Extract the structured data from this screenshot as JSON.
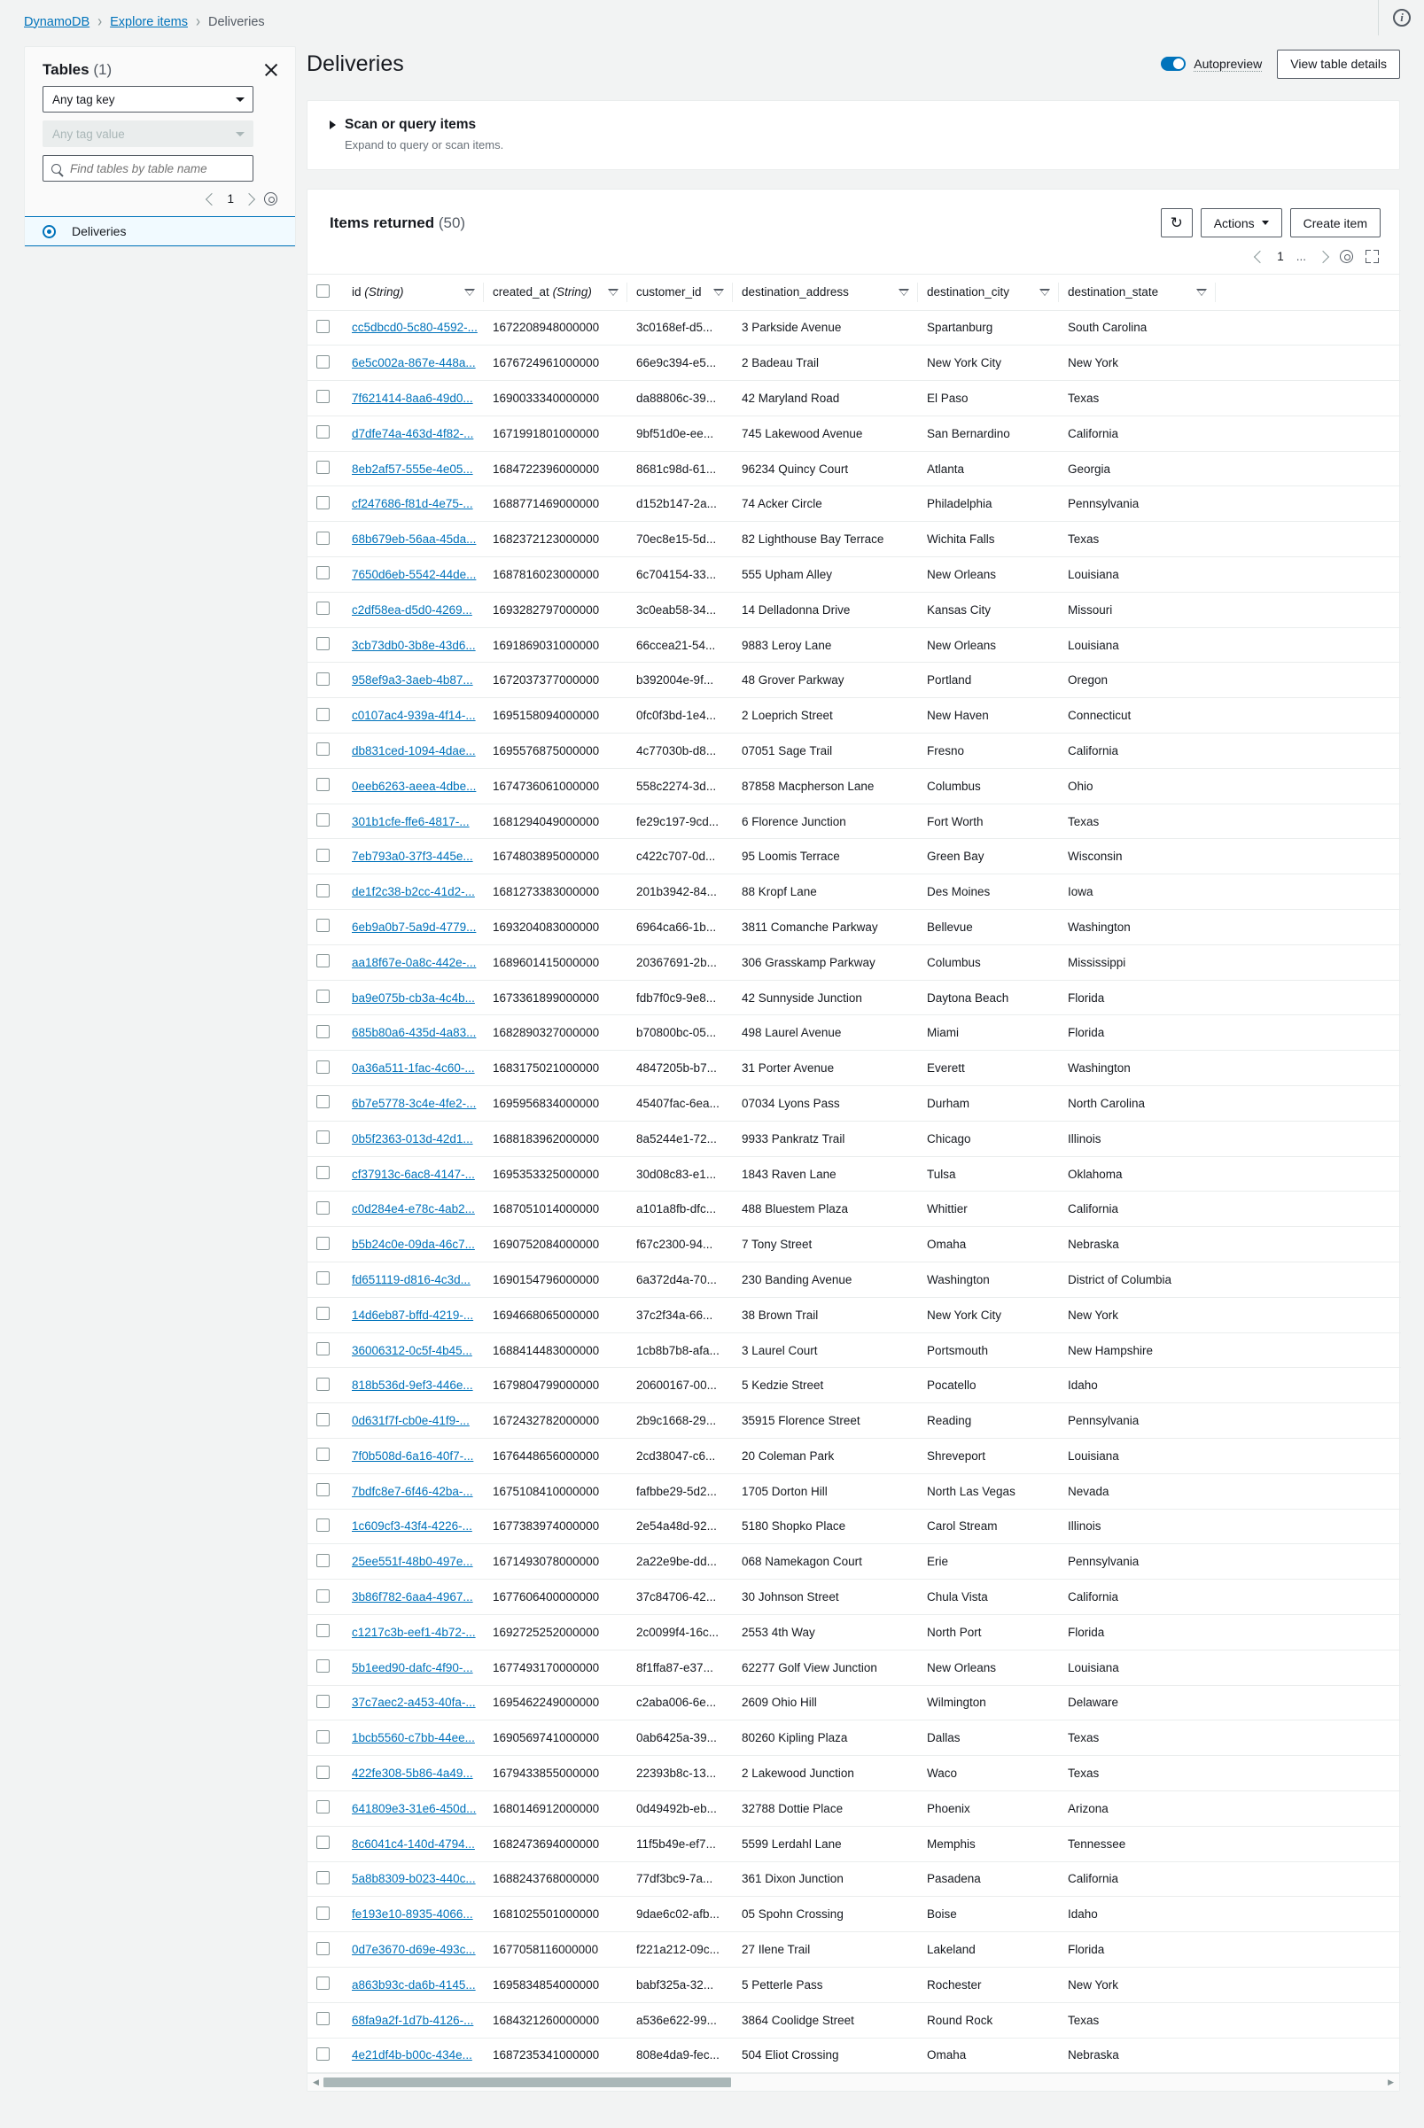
{
  "breadcrumb": {
    "items": [
      {
        "label": "DynamoDB",
        "link": true
      },
      {
        "label": "Explore items",
        "link": true
      },
      {
        "label": "Deliveries",
        "link": false
      }
    ],
    "separator": "›"
  },
  "topbar": {
    "info_icon": "info-icon"
  },
  "sidebar": {
    "title": "Tables",
    "count": "(1)",
    "close_icon": "close-icon",
    "tag_key_select": "Any tag key",
    "tag_value_select": "Any tag value",
    "search_placeholder": "Find tables by table name",
    "search_value": "",
    "search_icon": "search-icon",
    "pager": {
      "prev": "‹",
      "page": "1",
      "next": "›",
      "settings_icon": "gear-icon"
    },
    "items": [
      {
        "label": "Deliveries",
        "selected": true
      }
    ]
  },
  "header": {
    "title": "Deliveries",
    "autopreview_label": "Autopreview",
    "autopreview_on": true,
    "view_table_details": "View table details"
  },
  "scan_panel": {
    "title": "Scan or query items",
    "subtitle": "Expand to query or scan items.",
    "expand_icon": "triangle-right-icon"
  },
  "items_panel": {
    "title": "Items returned",
    "count": "(50)",
    "refresh_icon": "refresh-icon",
    "actions_label": "Actions",
    "create_item_label": "Create item",
    "pager": {
      "prev": "‹",
      "page": "1",
      "ellipsis": "...",
      "next": "›",
      "settings_icon": "gear-icon",
      "fullscreen_icon": "expand-icon"
    },
    "columns": [
      {
        "label": "id",
        "type": "(String)"
      },
      {
        "label": "created_at",
        "type": "(String)"
      },
      {
        "label": "customer_id",
        "type": ""
      },
      {
        "label": "destination_address",
        "type": ""
      },
      {
        "label": "destination_city",
        "type": ""
      },
      {
        "label": "destination_state",
        "type": ""
      }
    ],
    "rows": [
      {
        "id": "cc5dbcd0-5c80-4592-...",
        "created_at": "1672208948000000",
        "customer_id": "3c0168ef-d5...",
        "destination_address": "3 Parkside Avenue",
        "destination_city": "Spartanburg",
        "destination_state": "South Carolina"
      },
      {
        "id": "6e5c002a-867e-448a...",
        "created_at": "1676724961000000",
        "customer_id": "66e9c394-e5...",
        "destination_address": "2 Badeau Trail",
        "destination_city": "New York City",
        "destination_state": "New York"
      },
      {
        "id": "7f621414-8aa6-49d0...",
        "created_at": "1690033340000000",
        "customer_id": "da88806c-39...",
        "destination_address": "42 Maryland Road",
        "destination_city": "El Paso",
        "destination_state": "Texas"
      },
      {
        "id": "d7dfe74a-463d-4f82-...",
        "created_at": "1671991801000000",
        "customer_id": "9bf51d0e-ee...",
        "destination_address": "745 Lakewood Avenue",
        "destination_city": "San Bernardino",
        "destination_state": "California"
      },
      {
        "id": "8eb2af57-555e-4e05...",
        "created_at": "1684722396000000",
        "customer_id": "8681c98d-61...",
        "destination_address": "96234 Quincy Court",
        "destination_city": "Atlanta",
        "destination_state": "Georgia"
      },
      {
        "id": "cf247686-f81d-4e75-...",
        "created_at": "1688771469000000",
        "customer_id": "d152b147-2a...",
        "destination_address": "74 Acker Circle",
        "destination_city": "Philadelphia",
        "destination_state": "Pennsylvania"
      },
      {
        "id": "68b679eb-56aa-45da...",
        "created_at": "1682372123000000",
        "customer_id": "70ec8e15-5d...",
        "destination_address": "82 Lighthouse Bay Terrace",
        "destination_city": "Wichita Falls",
        "destination_state": "Texas"
      },
      {
        "id": "7650d6eb-5542-44de...",
        "created_at": "1687816023000000",
        "customer_id": "6c704154-33...",
        "destination_address": "555 Upham Alley",
        "destination_city": "New Orleans",
        "destination_state": "Louisiana"
      },
      {
        "id": "c2df58ea-d5d0-4269...",
        "created_at": "1693282797000000",
        "customer_id": "3c0eab58-34...",
        "destination_address": "14 Delladonna Drive",
        "destination_city": "Kansas City",
        "destination_state": "Missouri"
      },
      {
        "id": "3cb73db0-3b8e-43d6...",
        "created_at": "1691869031000000",
        "customer_id": "66ccea21-54...",
        "destination_address": "9883 Leroy Lane",
        "destination_city": "New Orleans",
        "destination_state": "Louisiana"
      },
      {
        "id": "958ef9a3-3aeb-4b87...",
        "created_at": "1672037377000000",
        "customer_id": "b392004e-9f...",
        "destination_address": "48 Grover Parkway",
        "destination_city": "Portland",
        "destination_state": "Oregon"
      },
      {
        "id": "c0107ac4-939a-4f14-...",
        "created_at": "1695158094000000",
        "customer_id": "0fc0f3bd-1e4...",
        "destination_address": "2 Loeprich Street",
        "destination_city": "New Haven",
        "destination_state": "Connecticut"
      },
      {
        "id": "db831ced-1094-4dae...",
        "created_at": "1695576875000000",
        "customer_id": "4c77030b-d8...",
        "destination_address": "07051 Sage Trail",
        "destination_city": "Fresno",
        "destination_state": "California"
      },
      {
        "id": "0eeb6263-aeea-4dbe...",
        "created_at": "1674736061000000",
        "customer_id": "558c2274-3d...",
        "destination_address": "87858 Macpherson Lane",
        "destination_city": "Columbus",
        "destination_state": "Ohio"
      },
      {
        "id": "301b1cfe-ffe6-4817-...",
        "created_at": "1681294049000000",
        "customer_id": "fe29c197-9cd...",
        "destination_address": "6 Florence Junction",
        "destination_city": "Fort Worth",
        "destination_state": "Texas"
      },
      {
        "id": "7eb793a0-37f3-445e...",
        "created_at": "1674803895000000",
        "customer_id": "c422c707-0d...",
        "destination_address": "95 Loomis Terrace",
        "destination_city": "Green Bay",
        "destination_state": "Wisconsin"
      },
      {
        "id": "de1f2c38-b2cc-41d2-...",
        "created_at": "1681273383000000",
        "customer_id": "201b3942-84...",
        "destination_address": "88 Kropf Lane",
        "destination_city": "Des Moines",
        "destination_state": "Iowa"
      },
      {
        "id": "6eb9a0b7-5a9d-4779...",
        "created_at": "1693204083000000",
        "customer_id": "6964ca66-1b...",
        "destination_address": "3811 Comanche Parkway",
        "destination_city": "Bellevue",
        "destination_state": "Washington"
      },
      {
        "id": "aa18f67e-0a8c-442e-...",
        "created_at": "1689601415000000",
        "customer_id": "20367691-2b...",
        "destination_address": "306 Grasskamp Parkway",
        "destination_city": "Columbus",
        "destination_state": "Mississippi"
      },
      {
        "id": "ba9e075b-cb3a-4c4b...",
        "created_at": "1673361899000000",
        "customer_id": "fdb7f0c9-9e8...",
        "destination_address": "42 Sunnyside Junction",
        "destination_city": "Daytona Beach",
        "destination_state": "Florida"
      },
      {
        "id": "685b80a6-435d-4a83...",
        "created_at": "1682890327000000",
        "customer_id": "b70800bc-05...",
        "destination_address": "498 Laurel Avenue",
        "destination_city": "Miami",
        "destination_state": "Florida"
      },
      {
        "id": "0a36a511-1fac-4c60-...",
        "created_at": "1683175021000000",
        "customer_id": "4847205b-b7...",
        "destination_address": "31 Porter Avenue",
        "destination_city": "Everett",
        "destination_state": "Washington"
      },
      {
        "id": "6b7e5778-3c4e-4fe2-...",
        "created_at": "1695956834000000",
        "customer_id": "45407fac-6ea...",
        "destination_address": "07034 Lyons Pass",
        "destination_city": "Durham",
        "destination_state": "North Carolina"
      },
      {
        "id": "0b5f2363-013d-42d1...",
        "created_at": "1688183962000000",
        "customer_id": "8a5244e1-72...",
        "destination_address": "9933 Pankratz Trail",
        "destination_city": "Chicago",
        "destination_state": "Illinois"
      },
      {
        "id": "cf37913c-6ac8-4147-...",
        "created_at": "1695353325000000",
        "customer_id": "30d08c83-e1...",
        "destination_address": "1843 Raven Lane",
        "destination_city": "Tulsa",
        "destination_state": "Oklahoma"
      },
      {
        "id": "c0d284e4-e78c-4ab2...",
        "created_at": "1687051014000000",
        "customer_id": "a101a8fb-dfc...",
        "destination_address": "488 Bluestem Plaza",
        "destination_city": "Whittier",
        "destination_state": "California"
      },
      {
        "id": "b5b24c0e-09da-46c7...",
        "created_at": "1690752084000000",
        "customer_id": "f67c2300-94...",
        "destination_address": "7 Tony Street",
        "destination_city": "Omaha",
        "destination_state": "Nebraska"
      },
      {
        "id": "fd651119-d816-4c3d...",
        "created_at": "1690154796000000",
        "customer_id": "6a372d4a-70...",
        "destination_address": "230 Banding Avenue",
        "destination_city": "Washington",
        "destination_state": "District of Columbia"
      },
      {
        "id": "14d6eb87-bffd-4219-...",
        "created_at": "1694668065000000",
        "customer_id": "37c2f34a-66...",
        "destination_address": "38 Brown Trail",
        "destination_city": "New York City",
        "destination_state": "New York"
      },
      {
        "id": "36006312-0c5f-4b45...",
        "created_at": "1688414483000000",
        "customer_id": "1cb8b7b8-afa...",
        "destination_address": "3 Laurel Court",
        "destination_city": "Portsmouth",
        "destination_state": "New Hampshire"
      },
      {
        "id": "818b536d-9ef3-446e...",
        "created_at": "1679804799000000",
        "customer_id": "20600167-00...",
        "destination_address": "5 Kedzie Street",
        "destination_city": "Pocatello",
        "destination_state": "Idaho"
      },
      {
        "id": "0d631f7f-cb0e-41f9-...",
        "created_at": "1672432782000000",
        "customer_id": "2b9c1668-29...",
        "destination_address": "35915 Florence Street",
        "destination_city": "Reading",
        "destination_state": "Pennsylvania"
      },
      {
        "id": "7f0b508d-6a16-40f7-...",
        "created_at": "1676448656000000",
        "customer_id": "2cd38047-c6...",
        "destination_address": "20 Coleman Park",
        "destination_city": "Shreveport",
        "destination_state": "Louisiana"
      },
      {
        "id": "7bdfc8e7-6f46-42ba-...",
        "created_at": "1675108410000000",
        "customer_id": "fafbbe29-5d2...",
        "destination_address": "1705 Dorton Hill",
        "destination_city": "North Las Vegas",
        "destination_state": "Nevada"
      },
      {
        "id": "1c609cf3-43f4-4226-...",
        "created_at": "1677383974000000",
        "customer_id": "2e54a48d-92...",
        "destination_address": "5180 Shopko Place",
        "destination_city": "Carol Stream",
        "destination_state": "Illinois"
      },
      {
        "id": "25ee551f-48b0-497e...",
        "created_at": "1671493078000000",
        "customer_id": "2a22e9be-dd...",
        "destination_address": "068 Namekagon Court",
        "destination_city": "Erie",
        "destination_state": "Pennsylvania"
      },
      {
        "id": "3b86f782-6aa4-4967...",
        "created_at": "1677606400000000",
        "customer_id": "37c84706-42...",
        "destination_address": "30 Johnson Street",
        "destination_city": "Chula Vista",
        "destination_state": "California"
      },
      {
        "id": "c1217c3b-eef1-4b72-...",
        "created_at": "1692725252000000",
        "customer_id": "2c0099f4-16c...",
        "destination_address": "2553 4th Way",
        "destination_city": "North Port",
        "destination_state": "Florida"
      },
      {
        "id": "5b1eed90-dafc-4f90-...",
        "created_at": "1677493170000000",
        "customer_id": "8f1ffa87-e37...",
        "destination_address": "62277 Golf View Junction",
        "destination_city": "New Orleans",
        "destination_state": "Louisiana"
      },
      {
        "id": "37c7aec2-a453-40fa-...",
        "created_at": "1695462249000000",
        "customer_id": "c2aba006-6e...",
        "destination_address": "2609 Ohio Hill",
        "destination_city": "Wilmington",
        "destination_state": "Delaware"
      },
      {
        "id": "1bcb5560-c7bb-44ee...",
        "created_at": "1690569741000000",
        "customer_id": "0ab6425a-39...",
        "destination_address": "80260 Kipling Plaza",
        "destination_city": "Dallas",
        "destination_state": "Texas"
      },
      {
        "id": "422fe308-5b86-4a49...",
        "created_at": "1679433855000000",
        "customer_id": "22393b8c-13...",
        "destination_address": "2 Lakewood Junction",
        "destination_city": "Waco",
        "destination_state": "Texas"
      },
      {
        "id": "641809e3-31e6-450d...",
        "created_at": "1680146912000000",
        "customer_id": "0d49492b-eb...",
        "destination_address": "32788 Dottie Place",
        "destination_city": "Phoenix",
        "destination_state": "Arizona"
      },
      {
        "id": "8c6041c4-140d-4794...",
        "created_at": "1682473694000000",
        "customer_id": "11f5b49e-ef7...",
        "destination_address": "5599 Lerdahl Lane",
        "destination_city": "Memphis",
        "destination_state": "Tennessee"
      },
      {
        "id": "5a8b8309-b023-440c...",
        "created_at": "1688243768000000",
        "customer_id": "77df3bc9-7a...",
        "destination_address": "361 Dixon Junction",
        "destination_city": "Pasadena",
        "destination_state": "California"
      },
      {
        "id": "fe193e10-8935-4066...",
        "created_at": "1681025501000000",
        "customer_id": "9dae6c02-afb...",
        "destination_address": "05 Spohn Crossing",
        "destination_city": "Boise",
        "destination_state": "Idaho"
      },
      {
        "id": "0d7e3670-d69e-493c...",
        "created_at": "1677058116000000",
        "customer_id": "f221a212-09c...",
        "destination_address": "27 Ilene Trail",
        "destination_city": "Lakeland",
        "destination_state": "Florida"
      },
      {
        "id": "a863b93c-da6b-4145...",
        "created_at": "1695834854000000",
        "customer_id": "babf325a-32...",
        "destination_address": "5 Petterle Pass",
        "destination_city": "Rochester",
        "destination_state": "New York"
      },
      {
        "id": "68fa9a2f-1d7b-4126-...",
        "created_at": "1684321260000000",
        "customer_id": "a536e622-99...",
        "destination_address": "3864 Coolidge Street",
        "destination_city": "Round Rock",
        "destination_state": "Texas"
      },
      {
        "id": "4e21df4b-b00c-434e...",
        "created_at": "1687235341000000",
        "customer_id": "808e4da9-fec...",
        "destination_address": "504 Eliot Crossing",
        "destination_city": "Omaha",
        "destination_state": "Nebraska"
      }
    ]
  },
  "colors": {
    "accent": "#0073bb",
    "page_bg": "#f2f3f3",
    "panel_bg": "#ffffff",
    "border": "#eaeded"
  }
}
